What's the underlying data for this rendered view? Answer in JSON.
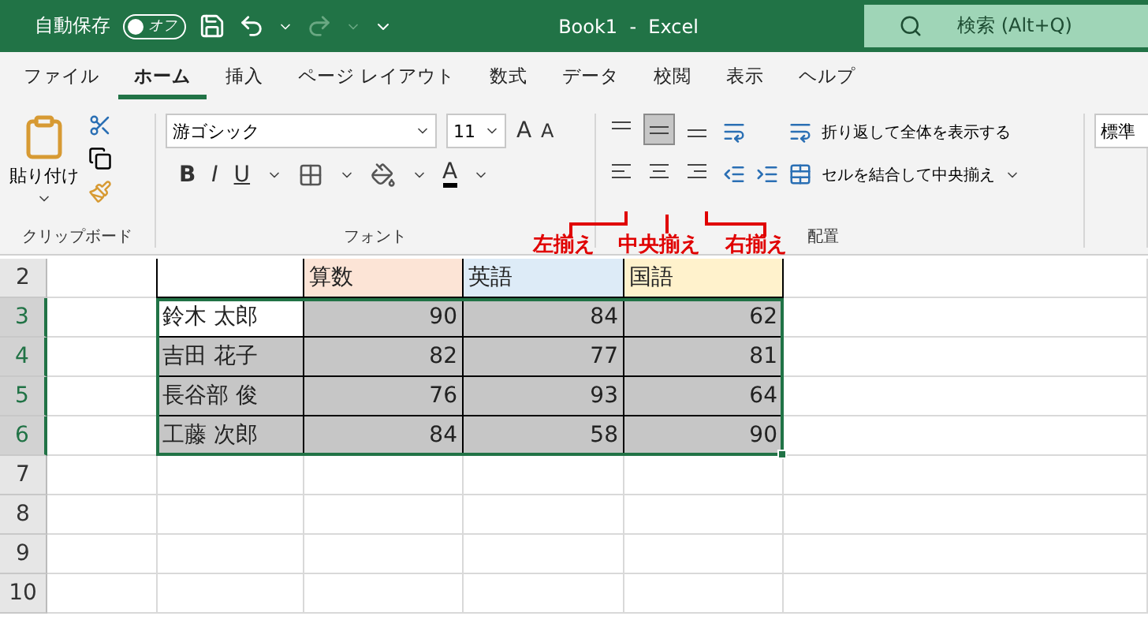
{
  "title_bar": {
    "autosave_label": "自動保存",
    "autosave_toggle": {
      "label": "オフ",
      "on": false
    },
    "title": "Book1  -  Excel",
    "search": {
      "placeholder": "検索 (Alt+Q)"
    }
  },
  "tabs": [
    {
      "label": "ファイル",
      "selected": false
    },
    {
      "label": "ホーム",
      "selected": true
    },
    {
      "label": "挿入",
      "selected": false
    },
    {
      "label": "ページ レイアウト",
      "selected": false
    },
    {
      "label": "数式",
      "selected": false
    },
    {
      "label": "データ",
      "selected": false
    },
    {
      "label": "校閲",
      "selected": false
    },
    {
      "label": "表示",
      "selected": false
    },
    {
      "label": "ヘルプ",
      "selected": false
    }
  ],
  "ribbon": {
    "clipboard": {
      "paste_label": "貼り付け",
      "group_label": "クリップボード"
    },
    "font": {
      "font_name": "游ゴシック",
      "font_size": "11",
      "grow_label": "A",
      "shrink_label": "A",
      "style_buttons": [
        "B",
        "I",
        "U"
      ],
      "font_color_label": "A",
      "group_label": "フォント"
    },
    "alignment": {
      "vertical": [
        {
          "selected": false
        },
        {
          "selected": true
        },
        {
          "selected": false
        }
      ],
      "horizontal": [
        {
          "selected": false
        },
        {
          "selected": false
        },
        {
          "selected": false
        }
      ],
      "wrap_text": "折り返して全体を表示する",
      "merge_center": "セルを結合して中央揃え",
      "group_label": "配置"
    },
    "number": {
      "format": "標準"
    }
  },
  "annotations": [
    {
      "text": "左揃え"
    },
    {
      "text": "中央揃え"
    },
    {
      "text": "右揃え"
    }
  ],
  "sheet": {
    "header": {
      "number": "2",
      "selected": false,
      "cells": [
        {
          "text": "",
          "color": "#ffffff"
        },
        {
          "text": "算数",
          "color": "#fce4d6"
        },
        {
          "text": "英語",
          "color": "#ddebf7"
        },
        {
          "text": "国語",
          "color": "#fff2cc"
        }
      ]
    },
    "rows": [
      {
        "number": "3",
        "selected": true,
        "name": "鈴木 太郎",
        "name_active": true,
        "scores": [
          "90",
          "84",
          "62"
        ]
      },
      {
        "number": "4",
        "selected": true,
        "name": "吉田 花子",
        "name_active": false,
        "scores": [
          "82",
          "77",
          "81"
        ]
      },
      {
        "number": "5",
        "selected": true,
        "name": "長谷部 俊",
        "name_active": false,
        "scores": [
          "76",
          "93",
          "64"
        ]
      },
      {
        "number": "6",
        "selected": true,
        "name": "工藤 次郎",
        "name_active": false,
        "scores": [
          "84",
          "58",
          "90"
        ]
      }
    ],
    "empty_rows": [
      {
        "number": "7",
        "selected": false
      },
      {
        "number": "8",
        "selected": false
      },
      {
        "number": "9",
        "selected": false
      },
      {
        "number": "10",
        "selected": false
      }
    ]
  }
}
